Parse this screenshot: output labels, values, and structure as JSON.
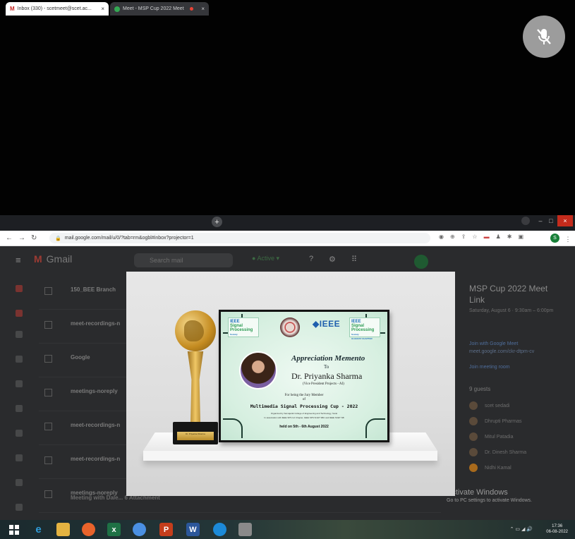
{
  "meet": {
    "mic_state": "muted"
  },
  "browser": {
    "tabs": [
      {
        "label": "Inbox (330) - scetmeet@scet.ac...",
        "icon": "gmail-icon",
        "active": true
      },
      {
        "label": "Meet - MSP Cup 2022 Meet",
        "icon": "meet-icon",
        "active": false
      }
    ],
    "url": "mail.google.com/mail/u/0/?tab=rm&ogbl#inbox?projector=1",
    "profile_initial": "S"
  },
  "gmail": {
    "app_name": "Gmail",
    "search_placeholder": "Search mail",
    "status": "Active",
    "rows": [
      {
        "sender": "150_BEE Branch"
      },
      {
        "sender": "meet-recordings-n"
      },
      {
        "sender": "Google"
      },
      {
        "sender": "meetings-noreply"
      },
      {
        "sender": "meet-recordings-n"
      },
      {
        "sender": "meet-recordings-n"
      },
      {
        "sender": "meetings-noreply"
      }
    ],
    "bottom_row_text": "Meeting with Dale... 6 Attachment",
    "event": {
      "title": "MSP Cup 2022 Meet Link",
      "date": "Saturday, August 6 · 9:30am – 6:00pm",
      "join": "Join with Google Meet",
      "link": "meet.google.com/ckr-dtpm-cv",
      "join_phone": "Join meeting room",
      "guests_title": "9 guests",
      "guests": [
        "scet sedadi",
        "Dhrupti Pharmas",
        "Mitul Patadia",
        "Dr. Dinesh Sharma",
        "Nidhi Kamal"
      ]
    }
  },
  "certificate": {
    "logo_left": [
      "IEEE",
      "Signal",
      "Processing",
      "Society"
    ],
    "logo_right": [
      "IEEE",
      "Signal",
      "Processing",
      "Society",
      "GUJARAT CHAPTER"
    ],
    "ieee": "IEEE",
    "title": "Appreciation Memento",
    "to": "To",
    "name": "Dr. Priyanka Sharma",
    "role": "(Vice President Projects - AI)",
    "jury_line": "For being the Jury Member",
    "of": "of",
    "event": "Multimedia Signal Processing Cup - 2022",
    "org1": "Organized by Sarvajanik College of Engineering and Technology, Surat",
    "org2": "In association with IEEE SPS GJ Chapter, IEEE SPS SCET SBC and IEEE SCET SB",
    "held": "held on 5th - 6th August 2022",
    "trophy_plate": "Dr. Priyanka Sharma"
  },
  "windows": {
    "activate_title": "Activate Windows",
    "activate_sub": "Go to PC settings to activate Windows.",
    "time": "17:36",
    "date": "06-08-2022"
  }
}
